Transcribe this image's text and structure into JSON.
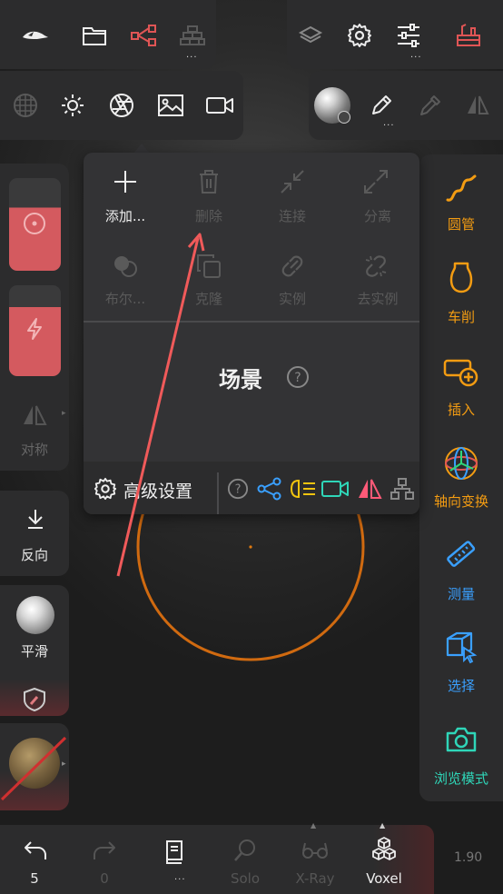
{
  "colors": {
    "accent": "#f39c12",
    "red": "#e05555",
    "teal": "#2fd6b8",
    "blue": "#3aa0ff",
    "disabled": "#5a5a5a"
  },
  "top_toolbar_left": [
    {
      "name": "app-logo-icon"
    },
    {
      "name": "folder-icon"
    },
    {
      "name": "share-graph-icon"
    },
    {
      "name": "bricks-icon",
      "label": "..."
    }
  ],
  "top_toolbar_right": [
    {
      "name": "layers-icon"
    },
    {
      "name": "gear-icon"
    },
    {
      "name": "sliders-icon",
      "label": "..."
    },
    {
      "name": "toolbox-icon"
    }
  ],
  "second_toolbar": [
    {
      "name": "grid-sphere-icon"
    },
    {
      "name": "sun-icon"
    },
    {
      "name": "aperture-icon"
    },
    {
      "name": "image-icon"
    },
    {
      "name": "camera-icon"
    }
  ],
  "material_toolbar": {
    "pen_dots": "..."
  },
  "scene_menu": {
    "row1": [
      {
        "icon": "plus-icon",
        "label": "添加...",
        "enabled": true
      },
      {
        "icon": "trash-icon",
        "label": "删除",
        "enabled": false
      },
      {
        "icon": "merge-arrows-icon",
        "label": "连接",
        "enabled": false
      },
      {
        "icon": "expand-arrows-icon",
        "label": "分离",
        "enabled": false
      }
    ],
    "row2": [
      {
        "icon": "boolean-icon",
        "label": "布尔...",
        "enabled": false
      },
      {
        "icon": "clone-icon",
        "label": "克隆",
        "enabled": false
      },
      {
        "icon": "link-icon",
        "label": "实例",
        "enabled": false
      },
      {
        "icon": "unlink-icon",
        "label": "去实例",
        "enabled": false
      }
    ],
    "title": "场景",
    "advanced_label": "高级设置"
  },
  "left_panel": {
    "symmetry_label": "对称",
    "reverse_label": "反向",
    "smooth_label": "平滑"
  },
  "right_tools": [
    {
      "icon": "tube-icon",
      "label": "圆管",
      "color": "#f39c12"
    },
    {
      "icon": "lathe-icon",
      "label": "车削",
      "color": "#f39c12"
    },
    {
      "icon": "insert-icon",
      "label": "插入",
      "color": "#f39c12"
    },
    {
      "icon": "gizmo-icon",
      "label": "轴向变换",
      "color": "#f39c12"
    },
    {
      "icon": "ruler-icon",
      "label": "测量",
      "color": "#3aa0ff"
    },
    {
      "icon": "select-cube-icon",
      "label": "选择",
      "color": "#3aa0ff"
    },
    {
      "icon": "camera-view-icon",
      "label": "浏览模式",
      "color": "#2fd6b8"
    }
  ],
  "bottom_bar": {
    "undo_count": "5",
    "redo_count": "0",
    "book_dots": "...",
    "solo": "Solo",
    "xray": "X-Ray",
    "voxel": "Voxel",
    "version": "1.90"
  }
}
